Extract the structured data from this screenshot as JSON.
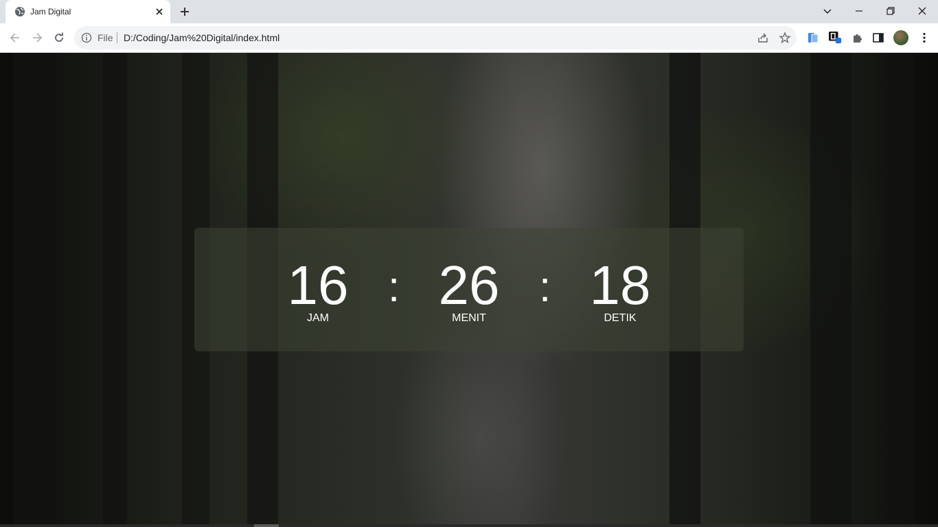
{
  "browser": {
    "tab": {
      "title": "Jam Digital",
      "favicon": "globe-icon"
    },
    "address": {
      "scheme": "File",
      "url": "D:/Coding/Jam%20Digital/index.html"
    },
    "toolbar_icons": [
      "back-icon",
      "forward-icon",
      "reload-icon",
      "site-info-icon",
      "share-icon",
      "bookmark-star-icon"
    ],
    "extensions": [
      "ext-translate-icon",
      "ext-notion-icon",
      "extensions-puzzle-icon",
      "side-panel-icon",
      "profile-avatar",
      "menu-kebab-icon"
    ],
    "window_controls": [
      "tab-search-icon",
      "minimize-icon",
      "restore-icon",
      "close-icon"
    ]
  },
  "clock": {
    "hours": {
      "value": "16",
      "label": "JAM"
    },
    "minutes": {
      "value": "26",
      "label": "MENIT"
    },
    "seconds": {
      "value": "18",
      "label": "DETIK"
    },
    "separator": ":"
  }
}
